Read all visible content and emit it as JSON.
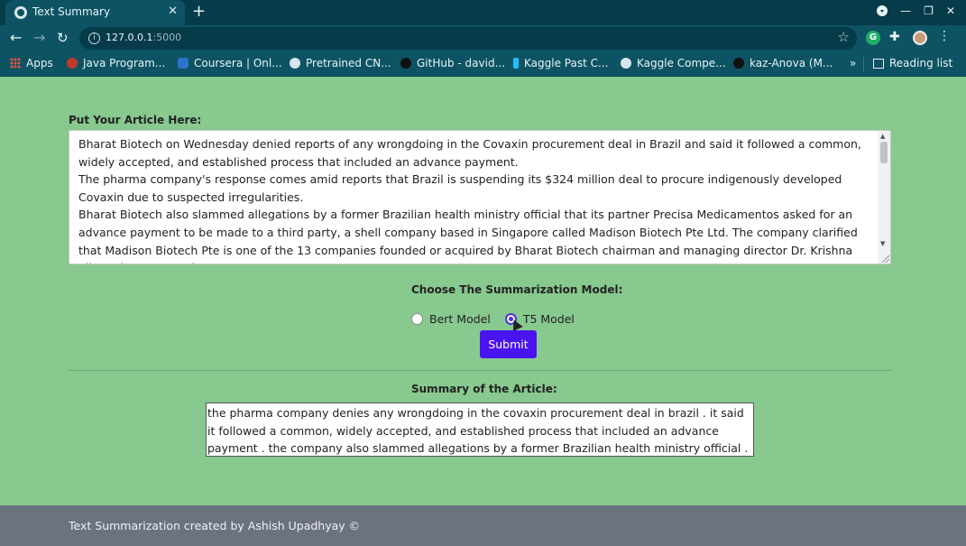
{
  "browser": {
    "tab_title": "Text Summary",
    "url_host": "127.0.0.1",
    "url_port": ":5000",
    "bookmarks": [
      {
        "label": "Apps"
      },
      {
        "label": "Java Program..."
      },
      {
        "label": "Coursera | Onl..."
      },
      {
        "label": "Pretrained CN..."
      },
      {
        "label": "GitHub - david..."
      },
      {
        "label": "Kaggle Past C..."
      },
      {
        "label": "Kaggle Compe..."
      },
      {
        "label": "kaz-Anova (M..."
      }
    ],
    "overflow_label": "»",
    "reading_list_label": "Reading list"
  },
  "form": {
    "article_label": "Put Your Article Here:",
    "article_text": "Bharat Biotech on Wednesday denied reports of any wrongdoing in the Covaxin procurement deal in Brazil and said it followed a common, widely accepted, and established process that included an advance payment.\nThe pharma company's response comes amid reports that Brazil is suspending its $324 million deal to procure indigenously developed Covaxin due to suspected irregularities.\nBharat Biotech also slammed allegations by a former Brazilian health ministry official that its partner Precisa Medicamentos asked for an advance payment to be made to a third party, a shell company based in Singapore called Madison Biotech Pte Ltd. The company clarified that Madison Biotech Pte is one of the 13 companies founded or acquired by Bharat Biotech chairman and managing director Dr. Krishna Ella and was set up in",
    "model_label": "Choose The Summarization Model:",
    "models": [
      {
        "label": "Bert Model",
        "checked": false
      },
      {
        "label": "T5 Model",
        "checked": true
      }
    ],
    "submit_label": "Submit"
  },
  "summary": {
    "label": "Summary of the Article:",
    "text": "the pharma company denies any wrongdoing in the covaxin procurement deal in brazil . it said it followed a common, widely accepted, and established process that included an advance payment . the company also slammed allegations by a former Brazilian health ministry official ."
  },
  "footer": {
    "text": "Text Summarization created by Ashish Upadhyay ©"
  },
  "colors": {
    "page_bg": "#88c98f",
    "accent": "#4a13f2",
    "footer_bg": "#6b7280",
    "chrome_bg": "#0d5363"
  }
}
